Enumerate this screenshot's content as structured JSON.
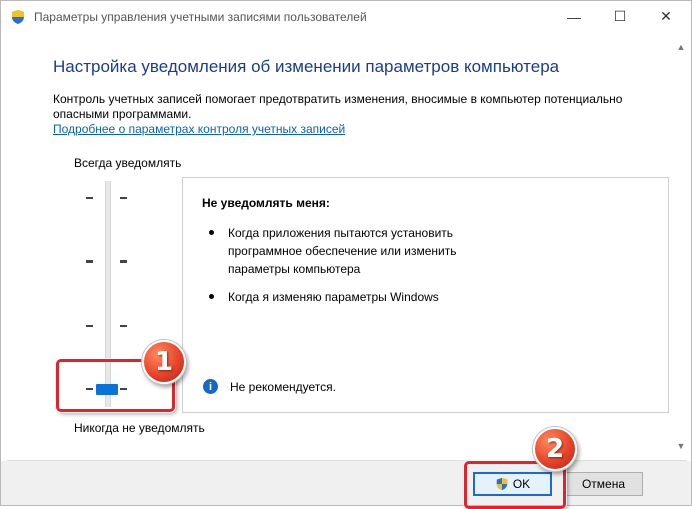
{
  "window": {
    "title": "Параметры управления учетными записями пользователей",
    "controls": {
      "minimize": "—",
      "maximize": "☐",
      "close": "✕"
    }
  },
  "main": {
    "heading": "Настройка уведомления об изменении параметров компьютера",
    "description": "Контроль учетных записей помогает предотвратить изменения, вносимые в компьютер потенциально опасными программами.",
    "learn_more_link": "Подробнее о параметрах контроля учетных записей"
  },
  "slider": {
    "top_label": "Всегда уведомлять",
    "bottom_label": "Никогда не уведомлять",
    "levels": 4,
    "selected_level": 1,
    "accent_color": "#0a73d9"
  },
  "info_panel": {
    "title": "Не уведомлять меня:",
    "bullets": [
      "Когда приложения пытаются установить программное обеспечение или изменить параметры компьютера",
      "Когда я изменяю параметры Windows"
    ],
    "note_icon": "info-icon",
    "note": "Не рекомендуется."
  },
  "buttons": {
    "ok": "OK",
    "cancel": "Отмена"
  },
  "annotations": {
    "badge_1": "1",
    "badge_2": "2",
    "highlight_color": "#e3232c"
  }
}
